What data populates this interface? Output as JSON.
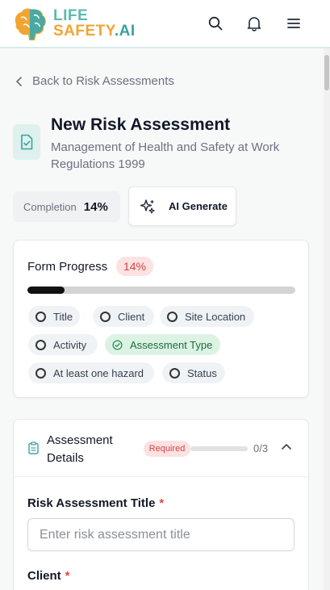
{
  "header": {
    "logo_line1": "LIFE",
    "logo_line2": "SAFETY",
    "logo_line2_suffix": ".AI",
    "icons": [
      "search-icon",
      "bell-icon",
      "menu-icon"
    ]
  },
  "back_link": {
    "label": "Back to Risk Assessments"
  },
  "page": {
    "title": "New Risk Assessment",
    "subtitle": "Management of Health and Safety at Work Regulations 1999"
  },
  "completion": {
    "label": "Completion",
    "value": "14%"
  },
  "ai_button": {
    "label": "AI Generate"
  },
  "form_progress": {
    "title": "Form Progress",
    "percent_label": "14%",
    "percent": 0.14,
    "chips": [
      {
        "label": "Title",
        "done": false
      },
      {
        "label": "Client",
        "done": false
      },
      {
        "label": "Site Location",
        "done": false
      },
      {
        "label": "Activity",
        "done": false
      },
      {
        "label": "Assessment Type",
        "done": true
      },
      {
        "label": "At least one hazard",
        "done": false
      },
      {
        "label": "Status",
        "done": false
      }
    ]
  },
  "assessment_details": {
    "title": "Assessment Details",
    "badge": "Required",
    "count": "0/3",
    "fields": {
      "title_label": "Risk Assessment Title",
      "title_placeholder": "Enter risk assessment title",
      "client_label": "Client",
      "required_mark": "*"
    }
  },
  "colors": {
    "accent": "#5cb8b2",
    "danger": "#d64545",
    "success": "#1d6b3c"
  }
}
